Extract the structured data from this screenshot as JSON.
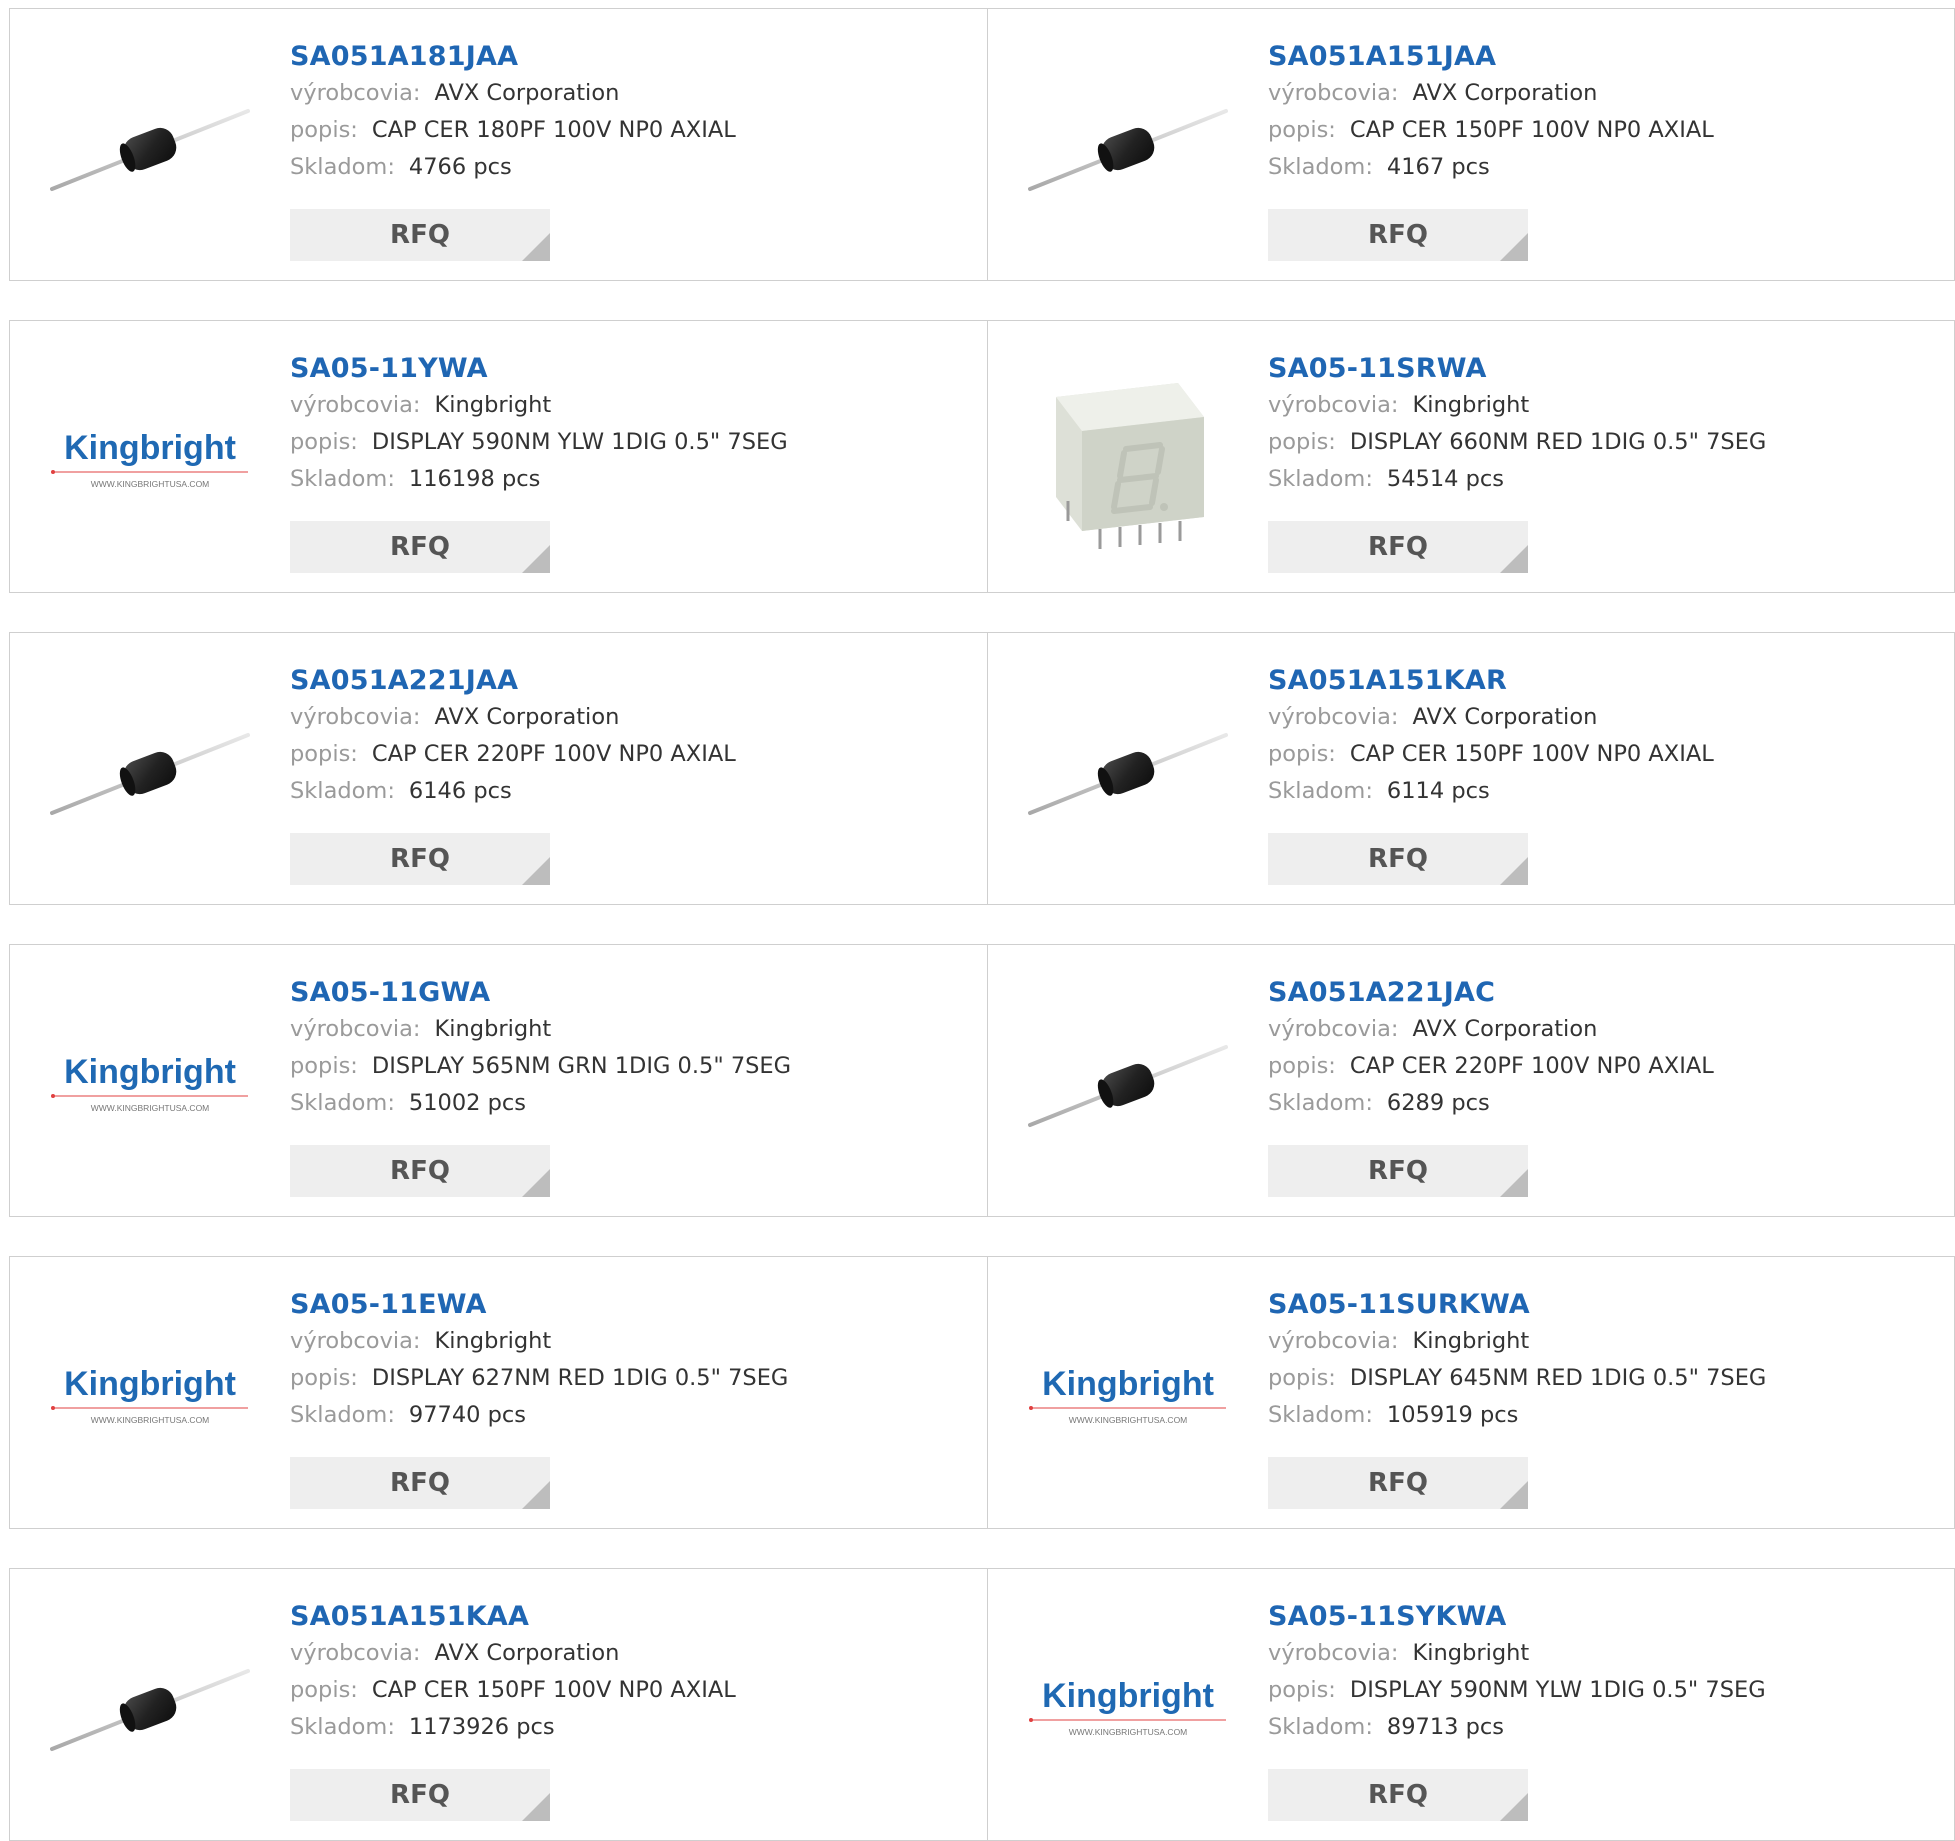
{
  "labels": {
    "manufacturer": "výrobcovia:",
    "description": "popis:",
    "stock": "Skladom:"
  },
  "rfq_label": "RFQ",
  "brand_logo": {
    "name": "Kingbright",
    "url": "WWW.KINGBRIGHTUSA.COM"
  },
  "colors": {
    "part_link": "#1f66b3",
    "label": "#9a9a9a",
    "rfq_bg": "#eeeeee",
    "border": "#cfcfcf"
  },
  "products": [
    {
      "part": "SA051A181JAA",
      "manufacturer": "AVX Corporation",
      "description": "CAP CER 180PF 100V NP0 AXIAL",
      "stock": "4766 pcs",
      "image": "axial-capacitor"
    },
    {
      "part": "SA051A151JAA",
      "manufacturer": "AVX Corporation",
      "description": "CAP CER 150PF 100V NP0 AXIAL",
      "stock": "4167 pcs",
      "image": "axial-capacitor"
    },
    {
      "part": "SA05-11YWA",
      "manufacturer": "Kingbright",
      "description": "DISPLAY 590NM YLW 1DIG 0.5\" 7SEG",
      "stock": "116198 pcs",
      "image": "kingbright-logo"
    },
    {
      "part": "SA05-11SRWA",
      "manufacturer": "Kingbright",
      "description": "DISPLAY 660NM RED 1DIG 0.5\" 7SEG",
      "stock": "54514 pcs",
      "image": "seven-segment-display"
    },
    {
      "part": "SA051A221JAA",
      "manufacturer": "AVX Corporation",
      "description": "CAP CER 220PF 100V NP0 AXIAL",
      "stock": "6146 pcs",
      "image": "axial-capacitor"
    },
    {
      "part": "SA051A151KAR",
      "manufacturer": "AVX Corporation",
      "description": "CAP CER 150PF 100V NP0 AXIAL",
      "stock": "6114 pcs",
      "image": "axial-capacitor"
    },
    {
      "part": "SA05-11GWA",
      "manufacturer": "Kingbright",
      "description": "DISPLAY 565NM GRN 1DIG 0.5\" 7SEG",
      "stock": "51002 pcs",
      "image": "kingbright-logo"
    },
    {
      "part": "SA051A221JAC",
      "manufacturer": "AVX Corporation",
      "description": "CAP CER 220PF 100V NP0 AXIAL",
      "stock": "6289 pcs",
      "image": "axial-capacitor"
    },
    {
      "part": "SA05-11EWA",
      "manufacturer": "Kingbright",
      "description": "DISPLAY 627NM RED 1DIG 0.5\" 7SEG",
      "stock": "97740 pcs",
      "image": "kingbright-logo"
    },
    {
      "part": "SA05-11SURKWA",
      "manufacturer": "Kingbright",
      "description": "DISPLAY 645NM RED 1DIG 0.5\" 7SEG",
      "stock": "105919 pcs",
      "image": "kingbright-logo"
    },
    {
      "part": "SA051A151KAA",
      "manufacturer": "AVX Corporation",
      "description": "CAP CER 150PF 100V NP0 AXIAL",
      "stock": "1173926 pcs",
      "image": "axial-capacitor"
    },
    {
      "part": "SA05-11SYKWA",
      "manufacturer": "Kingbright",
      "description": "DISPLAY 590NM YLW 1DIG 0.5\" 7SEG",
      "stock": "89713 pcs",
      "image": "kingbright-logo"
    }
  ]
}
